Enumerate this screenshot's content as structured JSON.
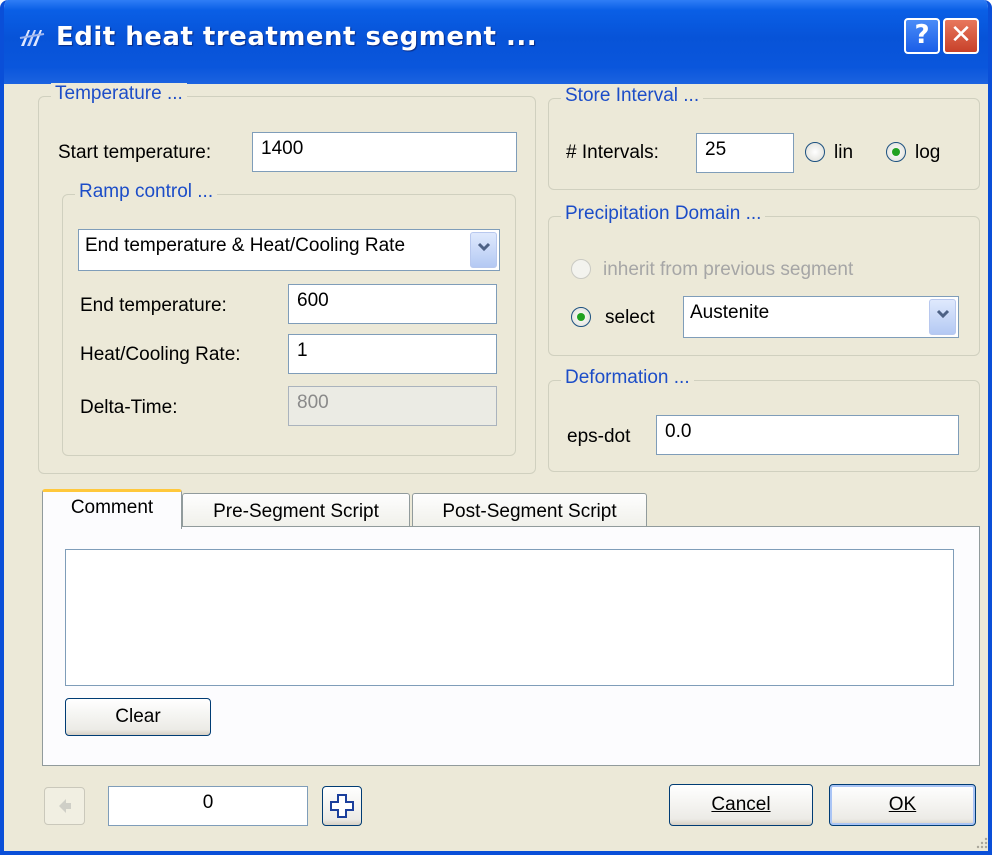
{
  "window": {
    "title": "Edit heat treatment segment ...",
    "help_label": "?",
    "close_label": "✕"
  },
  "temperature": {
    "group_title": "Temperature ...",
    "start_label": "Start temperature:",
    "start_value": "1400",
    "ramp": {
      "group_title": "Ramp control ...",
      "mode_selected": "End temperature & Heat/Cooling Rate",
      "end_label": "End temperature:",
      "end_value": "600",
      "rate_label": "Heat/Cooling Rate:",
      "rate_value": "1",
      "delta_label": "Delta-Time:",
      "delta_value": "800"
    }
  },
  "store_interval": {
    "group_title": "Store Interval ...",
    "intervals_label": "# Intervals:",
    "intervals_value": "25",
    "lin_label": "lin",
    "log_label": "log",
    "selected": "log"
  },
  "precipitation": {
    "group_title": "Precipitation Domain ...",
    "inherit_label": "inherit from previous segment",
    "select_label": "select",
    "domain_selected": "Austenite"
  },
  "deformation": {
    "group_title": "Deformation ...",
    "eps_label": "eps-dot",
    "eps_value": "0.0"
  },
  "tabs": {
    "items": [
      {
        "label": "Comment"
      },
      {
        "label": "Pre-Segment Script"
      },
      {
        "label": "Post-Segment Script"
      }
    ],
    "active": "Comment",
    "comment_text": "",
    "clear_label": "Clear"
  },
  "footer": {
    "counter_value": "0",
    "cancel_label": "Cancel",
    "ok_label": "OK"
  },
  "colors": {
    "title_bar": "#0753d8",
    "group_title": "#1c4dc8",
    "dialog_bg": "#ece9d8",
    "radio_dot": "#21a121"
  },
  "icons": [
    "app-icon",
    "help-icon",
    "close-icon",
    "chevron-down-icon",
    "arrow-left-icon",
    "plus-icon"
  ]
}
